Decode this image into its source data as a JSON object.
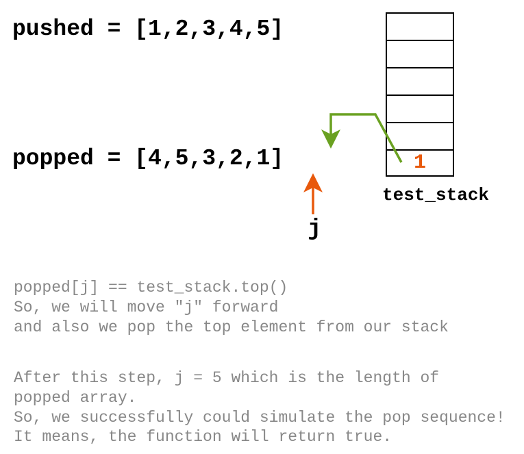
{
  "pushed": {
    "label": "pushed = [1,2,3,4,5]"
  },
  "popped": {
    "label": "popped = [4,5,3,2,1]"
  },
  "stack": {
    "cells": [
      "",
      "",
      "",
      "",
      "",
      "1"
    ],
    "label": "test_stack"
  },
  "pointer": {
    "label": "j"
  },
  "explain": {
    "block1": "popped[j] == test_stack.top()\nSo, we will move \"j\" forward\nand also we pop the top element from our stack",
    "block2": "After this step, j = 5 which is the length of\npopped array.\nSo, we successfully could simulate the pop sequence!\nIt means, the function will return true."
  },
  "colors": {
    "arrow_green": "#6aa121",
    "arrow_orange": "#e8590c"
  }
}
